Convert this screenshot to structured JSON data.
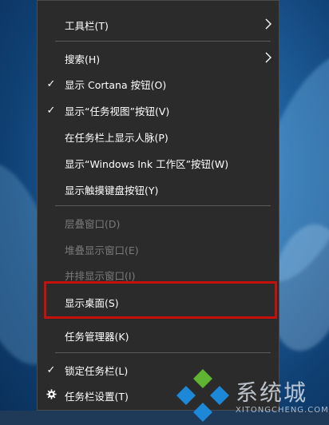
{
  "menu": {
    "items": [
      {
        "label": "工具栏(T)",
        "checked": false,
        "submenu": true,
        "disabled": false
      },
      {
        "label": "搜索(H)",
        "checked": false,
        "submenu": true,
        "disabled": false
      },
      {
        "label": "显示 Cortana 按钮(O)",
        "checked": true,
        "submenu": false,
        "disabled": false
      },
      {
        "label": "显示“任务视图”按钮(V)",
        "checked": true,
        "submenu": false,
        "disabled": false
      },
      {
        "label": "在任务栏上显示人脉(P)",
        "checked": false,
        "submenu": false,
        "disabled": false
      },
      {
        "label": "显示“Windows Ink 工作区”按钮(W)",
        "checked": false,
        "submenu": false,
        "disabled": false
      },
      {
        "label": "显示触摸键盘按钮(Y)",
        "checked": false,
        "submenu": false,
        "disabled": false
      },
      {
        "label": "层叠窗口(D)",
        "checked": false,
        "submenu": false,
        "disabled": true
      },
      {
        "label": "堆叠显示窗口(E)",
        "checked": false,
        "submenu": false,
        "disabled": true
      },
      {
        "label": "并排显示窗口(I)",
        "checked": false,
        "submenu": false,
        "disabled": true
      },
      {
        "label": "显示桌面(S)",
        "checked": false,
        "submenu": false,
        "disabled": false
      },
      {
        "label": "任务管理器(K)",
        "checked": false,
        "submenu": false,
        "disabled": false
      },
      {
        "label": "锁定任务栏(L)",
        "checked": true,
        "submenu": false,
        "disabled": false
      },
      {
        "label": "任务栏设置(T)",
        "checked": false,
        "submenu": false,
        "disabled": false,
        "icon": "gear-icon"
      }
    ],
    "check_glyph": "✓",
    "chevron_glyph": "›",
    "highlight_color": "#c5110c"
  },
  "watermark": {
    "text": "系统城",
    "subtext": "XITONGCHENG.COM"
  }
}
